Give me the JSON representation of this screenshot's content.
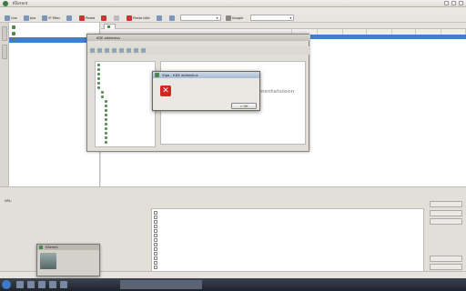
{
  "window": {
    "title": "KTorrent"
  },
  "menubar": [
    "",
    "",
    "",
    "",
    ""
  ],
  "toolbar": {
    "buttons": [
      {
        "label": "Uus",
        "icon": "new-icon",
        "enabled": true
      },
      {
        "label": "Ava",
        "icon": "open-icon",
        "enabled": true
      },
      {
        "label": "IP filter",
        "icon": "filter-icon",
        "enabled": true
      },
      {
        "label": "",
        "icon": "settings-icon",
        "enabled": true
      },
      {
        "label": "Peata",
        "icon": "stop-icon",
        "enabled": true
      },
      {
        "label": "",
        "icon": "remove-icon",
        "enabled": true
      },
      {
        "label": "",
        "icon": "start-all-icon",
        "enabled": false
      },
      {
        "label": "Peata kõik",
        "icon": "stop-all-icon",
        "enabled": true
      },
      {
        "label": "",
        "icon": "queue-icon",
        "enabled": true
      },
      {
        "label": "",
        "icon": "queue-manager-icon",
        "enabled": true
      }
    ],
    "combo_value": "",
    "search_label": "Google",
    "search_mode_label": "",
    "search_value": ""
  },
  "sidebar_tree": [
    {
      "label": "",
      "selected": false
    },
    {
      "label": "",
      "selected": false
    },
    {
      "label": "",
      "selected": true
    }
  ],
  "tab": {
    "label": ""
  },
  "columns": [
    "",
    "",
    "",
    "",
    "",
    "",
    ""
  ],
  "selected_row": [
    "",
    "",
    "",
    "",
    "",
    "",
    ""
  ],
  "inner_window": {
    "title": "KDE abikeskus",
    "menu": [
      "",
      "",
      "",
      "",
      ""
    ],
    "tree": [
      "",
      "",
      "",
      "",
      "",
      "",
      "",
      "",
      "",
      "",
      "",
      "",
      "",
      "",
      "",
      "",
      "",
      ""
    ],
    "message": "Abimentündes ühti kohta dokumentatsioon puudub.",
    "footer": ""
  },
  "dialog": {
    "title": "Viga - KDE abikeskus",
    "message": "",
    "ok_label": "OK"
  },
  "info_panel": {
    "section": "",
    "url_label": "URL:",
    "url_value": "",
    "fields": [
      {
        "label": "",
        "value": ""
      },
      {
        "label": "",
        "value": ""
      },
      {
        "label": "",
        "value": ""
      },
      {
        "label": "",
        "value": ""
      },
      {
        "label": "",
        "value": ""
      },
      {
        "label": "",
        "value": ""
      }
    ],
    "bottom_label": "",
    "bottom2_label": ""
  },
  "trackers": {
    "section": "",
    "items": [
      "",
      "",
      "",
      "",
      "",
      "",
      "",
      "",
      "",
      "",
      "",
      "",
      ""
    ]
  },
  "tracker_buttons": [
    "",
    "",
    "",
    "",
    ""
  ],
  "popup": {
    "title": "KTorrent",
    "name": "",
    "subtitle": ""
  },
  "statusbar": [
    "",
    "",
    "",
    "",
    ""
  ],
  "taskbar": {
    "task_label": "",
    "clock": ""
  }
}
